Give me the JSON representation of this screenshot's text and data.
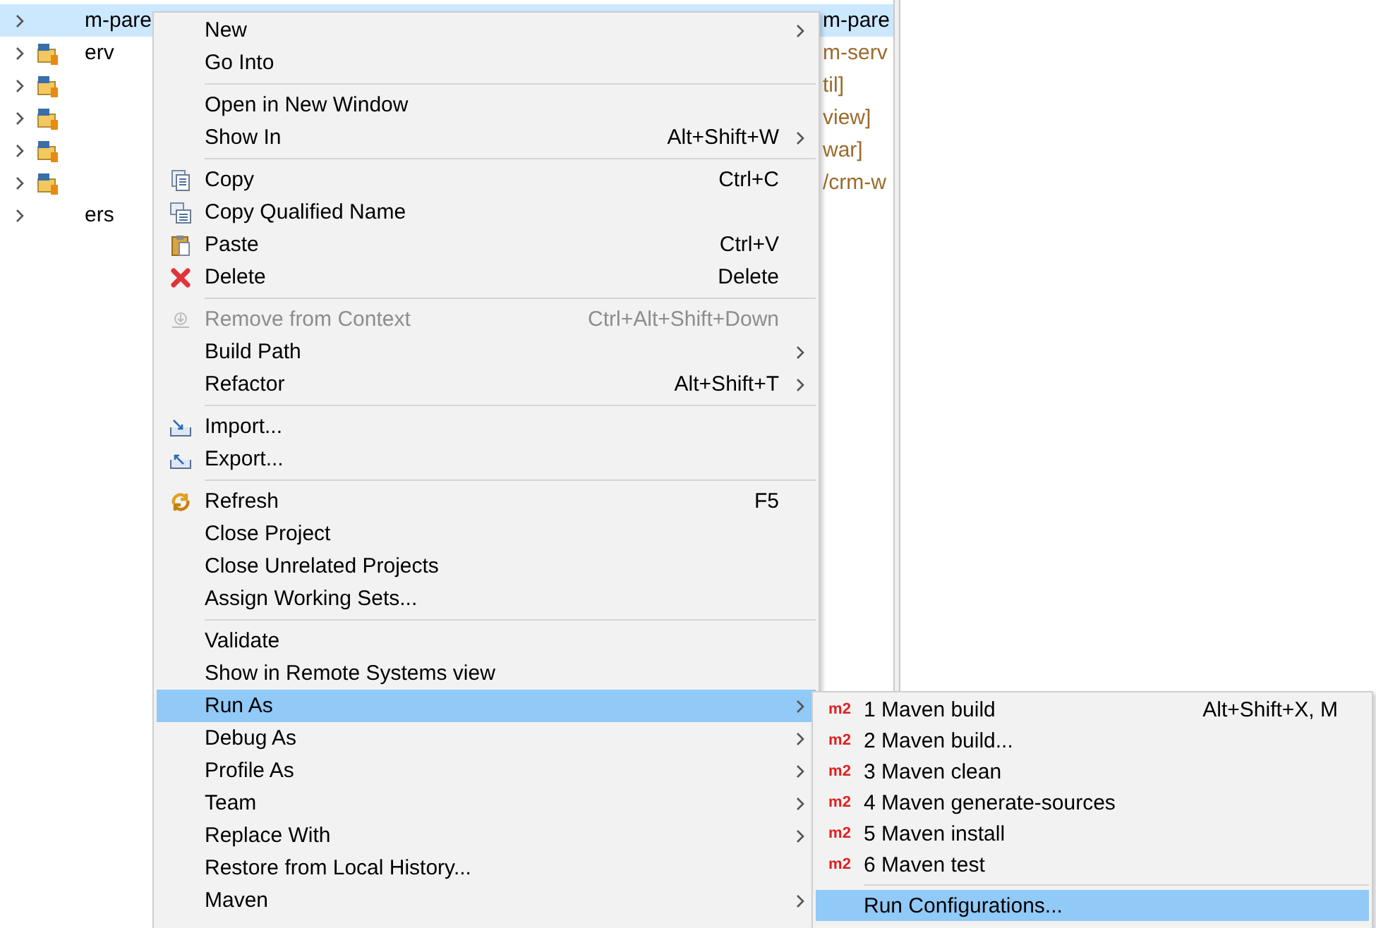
{
  "tree": {
    "rows": [
      {
        "kind": "folder",
        "name": "m-pare",
        "decoration": "m-pare",
        "selected": true
      },
      {
        "kind": "project",
        "name": "erv",
        "decoration": "m-serv",
        "selected": false
      },
      {
        "kind": "project",
        "decoration": "til]",
        "selected": false
      },
      {
        "kind": "project",
        "decoration": "view]",
        "selected": false
      },
      {
        "kind": "project",
        "decoration": "war]",
        "selected": false
      },
      {
        "kind": "project",
        "decoration": "/crm-w",
        "selected": false
      },
      {
        "kind": "folder",
        "name": "ers",
        "selected": false
      }
    ]
  },
  "context_menu": {
    "groups": [
      [
        {
          "label": "New",
          "submenu": true,
          "disabled": false,
          "selected": false
        },
        {
          "label": "Go Into",
          "submenu": false,
          "disabled": false,
          "selected": false
        }
      ],
      [
        {
          "label": "Open in New Window",
          "submenu": false,
          "disabled": false,
          "selected": false
        },
        {
          "label": "Show In",
          "shortcut": "Alt+Shift+W",
          "submenu": true,
          "disabled": false,
          "selected": false
        }
      ],
      [
        {
          "label": "Copy",
          "shortcut": "Ctrl+C",
          "submenu": false,
          "disabled": false,
          "selected": false
        },
        {
          "label": "Copy Qualified Name",
          "submenu": false,
          "disabled": false,
          "selected": false
        },
        {
          "label": "Paste",
          "shortcut": "Ctrl+V",
          "submenu": false,
          "disabled": false,
          "selected": false
        },
        {
          "label": "Delete",
          "shortcut": "Delete",
          "submenu": false,
          "disabled": false,
          "selected": false
        }
      ],
      [
        {
          "label": "Remove from Context",
          "shortcut": "Ctrl+Alt+Shift+Down",
          "submenu": false,
          "disabled": true,
          "selected": false
        },
        {
          "label": "Build Path",
          "submenu": true,
          "disabled": false,
          "selected": false
        },
        {
          "label": "Refactor",
          "shortcut": "Alt+Shift+T",
          "submenu": true,
          "disabled": false,
          "selected": false
        }
      ],
      [
        {
          "label": "Import...",
          "submenu": false,
          "disabled": false,
          "selected": false
        },
        {
          "label": "Export...",
          "submenu": false,
          "disabled": false,
          "selected": false
        }
      ],
      [
        {
          "label": "Refresh",
          "shortcut": "F5",
          "submenu": false,
          "disabled": false,
          "selected": false
        },
        {
          "label": "Close Project",
          "submenu": false,
          "disabled": false,
          "selected": false
        },
        {
          "label": "Close Unrelated Projects",
          "submenu": false,
          "disabled": false,
          "selected": false
        },
        {
          "label": "Assign Working Sets...",
          "submenu": false,
          "disabled": false,
          "selected": false
        }
      ],
      [
        {
          "label": "Validate",
          "submenu": false,
          "disabled": false,
          "selected": false
        },
        {
          "label": "Show in Remote Systems view",
          "submenu": false,
          "disabled": false,
          "selected": false
        },
        {
          "label": "Run As",
          "submenu": true,
          "disabled": false,
          "selected": true
        },
        {
          "label": "Debug As",
          "submenu": true,
          "disabled": false,
          "selected": false
        },
        {
          "label": "Profile As",
          "submenu": true,
          "disabled": false,
          "selected": false
        },
        {
          "label": "Team",
          "submenu": true,
          "disabled": false,
          "selected": false
        },
        {
          "label": "Replace With",
          "submenu": true,
          "disabled": false,
          "selected": false
        },
        {
          "label": "Restore from Local History...",
          "submenu": false,
          "disabled": false,
          "selected": false
        },
        {
          "label": "Maven",
          "submenu": true,
          "disabled": false,
          "selected": false
        }
      ]
    ]
  },
  "run_as_submenu": {
    "groups": [
      [
        {
          "badge": "m2",
          "label": "1 Maven build",
          "shortcut": "Alt+Shift+X, M",
          "selected": false
        },
        {
          "badge": "m2",
          "label": "2 Maven build...",
          "selected": false
        },
        {
          "badge": "m2",
          "label": "3 Maven clean",
          "selected": false
        },
        {
          "badge": "m2",
          "label": "4 Maven generate-sources",
          "selected": false
        },
        {
          "badge": "m2",
          "label": "5 Maven install",
          "selected": false
        },
        {
          "badge": "m2",
          "label": "6 Maven test",
          "selected": false
        }
      ],
      [
        {
          "label": "Run Configurations...",
          "selected": true
        }
      ]
    ]
  }
}
